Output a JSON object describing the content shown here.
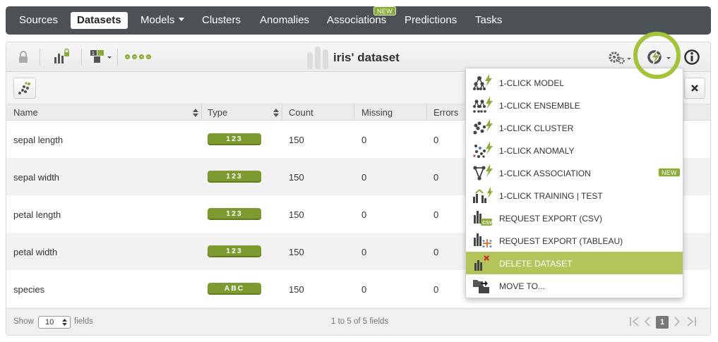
{
  "nav": {
    "items": [
      {
        "label": "Sources",
        "active": false
      },
      {
        "label": "Datasets",
        "active": true
      },
      {
        "label": "Models",
        "active": false,
        "dropdown": true
      },
      {
        "label": "Clusters",
        "active": false
      },
      {
        "label": "Anomalies",
        "active": false
      },
      {
        "label": "Associations",
        "active": false,
        "badge": "NEW"
      },
      {
        "label": "Predictions",
        "active": false
      },
      {
        "label": "Tasks",
        "active": false
      }
    ]
  },
  "toolbar": {
    "title": "iris' dataset",
    "icons": [
      "lock-icon",
      "field-stats-icon",
      "type-filter-icon",
      "progress-dots",
      "gear-icon",
      "one-click-icon",
      "info-icon"
    ]
  },
  "table": {
    "columns": [
      "Name",
      "Type",
      "Count",
      "Missing",
      "Errors"
    ],
    "rows": [
      {
        "name": "sepal length",
        "type": "123",
        "count": "150",
        "missing": "0",
        "errors": "0"
      },
      {
        "name": "sepal width",
        "type": "123",
        "count": "150",
        "missing": "0",
        "errors": "0"
      },
      {
        "name": "petal length",
        "type": "123",
        "count": "150",
        "missing": "0",
        "errors": "0"
      },
      {
        "name": "petal width",
        "type": "123",
        "count": "150",
        "missing": "0",
        "errors": "0"
      },
      {
        "name": "species",
        "type": "ABC",
        "count": "150",
        "missing": "0",
        "errors": "0"
      }
    ]
  },
  "footer": {
    "show_label": "Show",
    "page_size": "10",
    "fields_label": "fields",
    "range_text": "1 to 5 of 5 fields",
    "current_page": "1"
  },
  "menu": {
    "items": [
      {
        "label": "1-CLICK MODEL",
        "icon": "model-tree-icon"
      },
      {
        "label": "1-CLICK ENSEMBLE",
        "icon": "ensemble-icon"
      },
      {
        "label": "1-CLICK CLUSTER",
        "icon": "cluster-icon"
      },
      {
        "label": "1-CLICK ANOMALY",
        "icon": "anomaly-icon"
      },
      {
        "label": "1-CLICK ASSOCIATION",
        "icon": "association-icon",
        "badge": "NEW"
      },
      {
        "label": "1-CLICK TRAINING | TEST",
        "icon": "training-test-icon"
      },
      {
        "label": "REQUEST EXPORT (CSV)",
        "icon": "export-csv-icon"
      },
      {
        "label": "REQUEST EXPORT (TABLEAU)",
        "icon": "export-tableau-icon"
      },
      {
        "label": "DELETE DATASET",
        "icon": "delete-dataset-icon",
        "highlighted": true
      },
      {
        "label": "MOVE TO...",
        "icon": "move-to-icon"
      }
    ]
  },
  "colors": {
    "accent_green": "#8aab3a",
    "highlight": "#b3c45a",
    "nav_bg": "#4c5155",
    "badge_green": "#7c9a2f"
  }
}
